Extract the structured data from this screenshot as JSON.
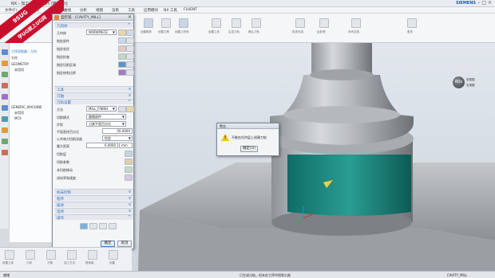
{
  "window": {
    "title": "NX - 加工 - [ZEN.prt (修改的)]",
    "brand": "SIEMENS",
    "controls": "– □ ×"
  },
  "menu": {
    "items": [
      "文件(F)",
      "主页",
      "装配",
      "曲线",
      "分析",
      "视图",
      "渲染",
      "工具",
      "应用模块",
      "NX 工具",
      "FLUENT"
    ]
  },
  "ribbon": {
    "labels": [
      "创建程序",
      "创建刀具",
      "创建几何体",
      "创建工序",
      "生成刀轨",
      "确认刀轨",
      "机床仿真",
      "后处理",
      "车间文档",
      "更多"
    ]
  },
  "watermark": {
    "line1": "9SUG",
    "line2": "学UG就上UG网"
  },
  "navigator": {
    "header": "工序导航器 - 几何",
    "col": "名称",
    "items": [
      "GEOMETRY",
      "未用项",
      "GENERIC_MACHINE",
      "未用项",
      "MCS"
    ]
  },
  "dialog": {
    "title": "型腔铣 - [CAVITY_MILL]",
    "sections": {
      "geometry": "几何体",
      "tool_axis": "工具",
      "tool": "刀轴",
      "cut_settings": "刀轨设置",
      "machine_ctrl": "机床控制",
      "program": "程序",
      "options": "选项",
      "actions": "操作",
      "description": "描述"
    },
    "rows": {
      "geom_label": "几何体",
      "geom_value": "WORKPIECE",
      "specify_part": "指定部件",
      "specify_blank": "指定毛坯",
      "specify_check": "指定检查",
      "specify_cut": "指定切削区域",
      "specify_trim": "指定修剪边界",
      "method_label": "方法",
      "method_value": "MILL_FINISH",
      "cut_mode_label": "切削模式",
      "cut_mode_value": "跟随部件",
      "step_label": "步距",
      "step_value": "刀具平直百分比",
      "pct_label": "平面直径百分比",
      "pct_value": "50.0000",
      "depth_label": "公共每刀切削深度",
      "depth_value": "恒定",
      "max_dist_label": "最大距离",
      "max_dist_value": "6.0000",
      "max_dist_unit": "mm",
      "cut_layers": "切削层",
      "cut_params": "切削参数",
      "non_cut": "非切削移动",
      "feeds": "进给率和速度"
    },
    "ok": "确定",
    "cancel": "取消"
  },
  "message": {
    "title": "警告",
    "text": "不能在任何层上创建刀轨",
    "ok": "确定(O)"
  },
  "viewcube": {
    "label": "60x",
    "side1": "前视图",
    "side2": "右视图"
  },
  "bottom": {
    "items": [
      "设置工序",
      "几何",
      "刀具",
      "加工方法",
      "程序组",
      "创建"
    ]
  },
  "status": {
    "left": "就绪",
    "middle": "已生成刀轨，但未在工序中找到刀具",
    "right": "CAVITY_MILL"
  }
}
